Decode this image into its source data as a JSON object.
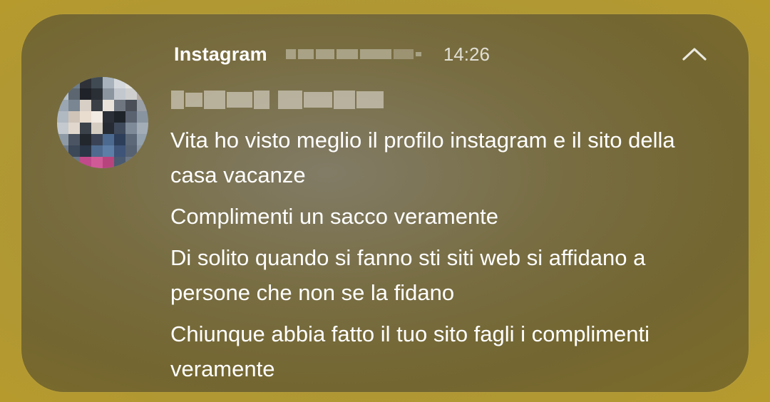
{
  "notification": {
    "app_name": "Instagram",
    "time": "14:26",
    "collapse_icon": "chevron-up-icon",
    "avatar_icon": "avatar-pixelated",
    "messages": [
      "Vita ho visto meglio il profilo instagram e il sito della casa vacanze",
      "Complimenti un sacco veramente",
      "Di solito quando si fanno sti siti web si affidano a persone che non se la fidano",
      "Chiunque abbia fatto il tuo sito fagli i complimenti veramente"
    ]
  },
  "colors": {
    "background": "#b09a35",
    "card": "#7a6e46",
    "text": "#ffffff"
  }
}
